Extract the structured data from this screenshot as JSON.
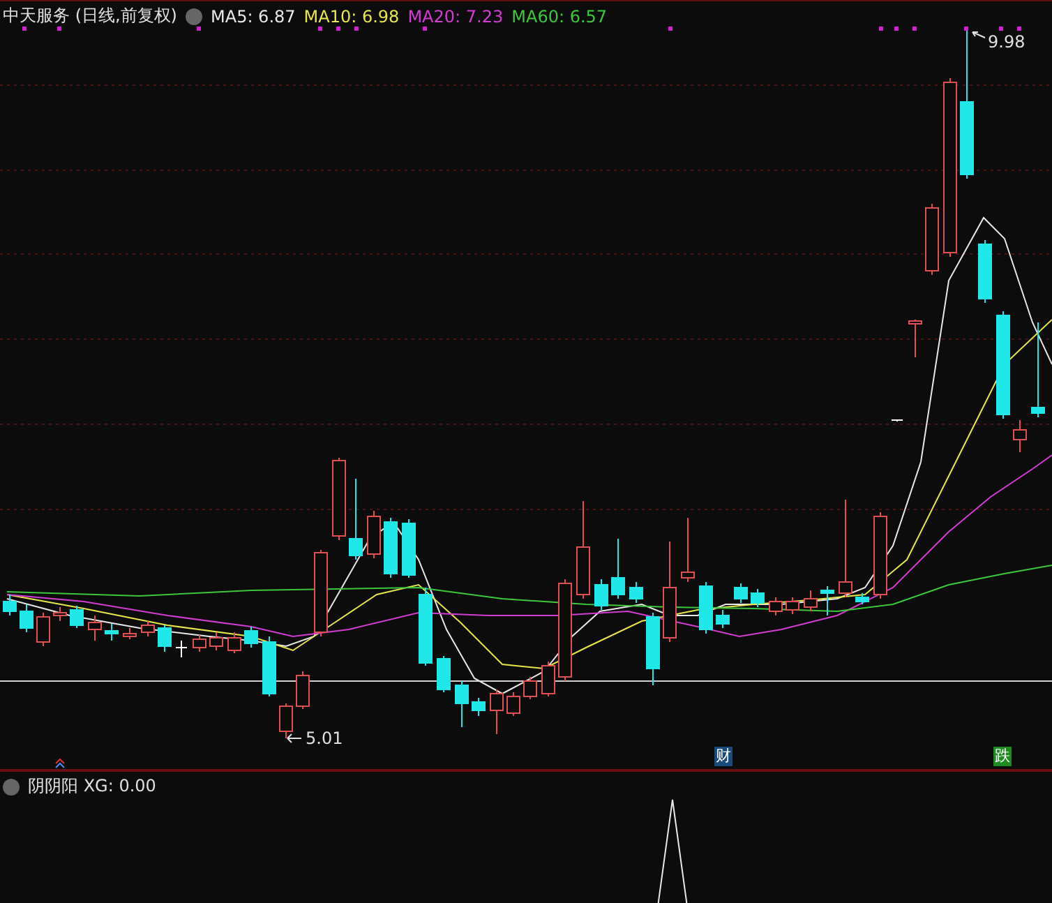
{
  "header": {
    "title": "中天服务 (日线,前复权)",
    "indicators": [
      {
        "label": "MA5: 6.87",
        "color": "#e8e8e8"
      },
      {
        "label": "MA10: 6.98",
        "color": "#e6e64a"
      },
      {
        "label": "MA20: 7.23",
        "color": "#d23cd2"
      },
      {
        "label": "MA60: 6.57",
        "color": "#3cc83c"
      }
    ]
  },
  "price_labels": [
    {
      "kind": "low",
      "text": "5.01"
    },
    {
      "kind": "high",
      "text": "9.98"
    }
  ],
  "badges": [
    {
      "text": "财",
      "color": "#1a4a7a"
    },
    {
      "text": "跌",
      "color": "#1f8a1f"
    }
  ],
  "indicator_panel": {
    "title": "阴阴阳 XG: 0.00"
  }
}
